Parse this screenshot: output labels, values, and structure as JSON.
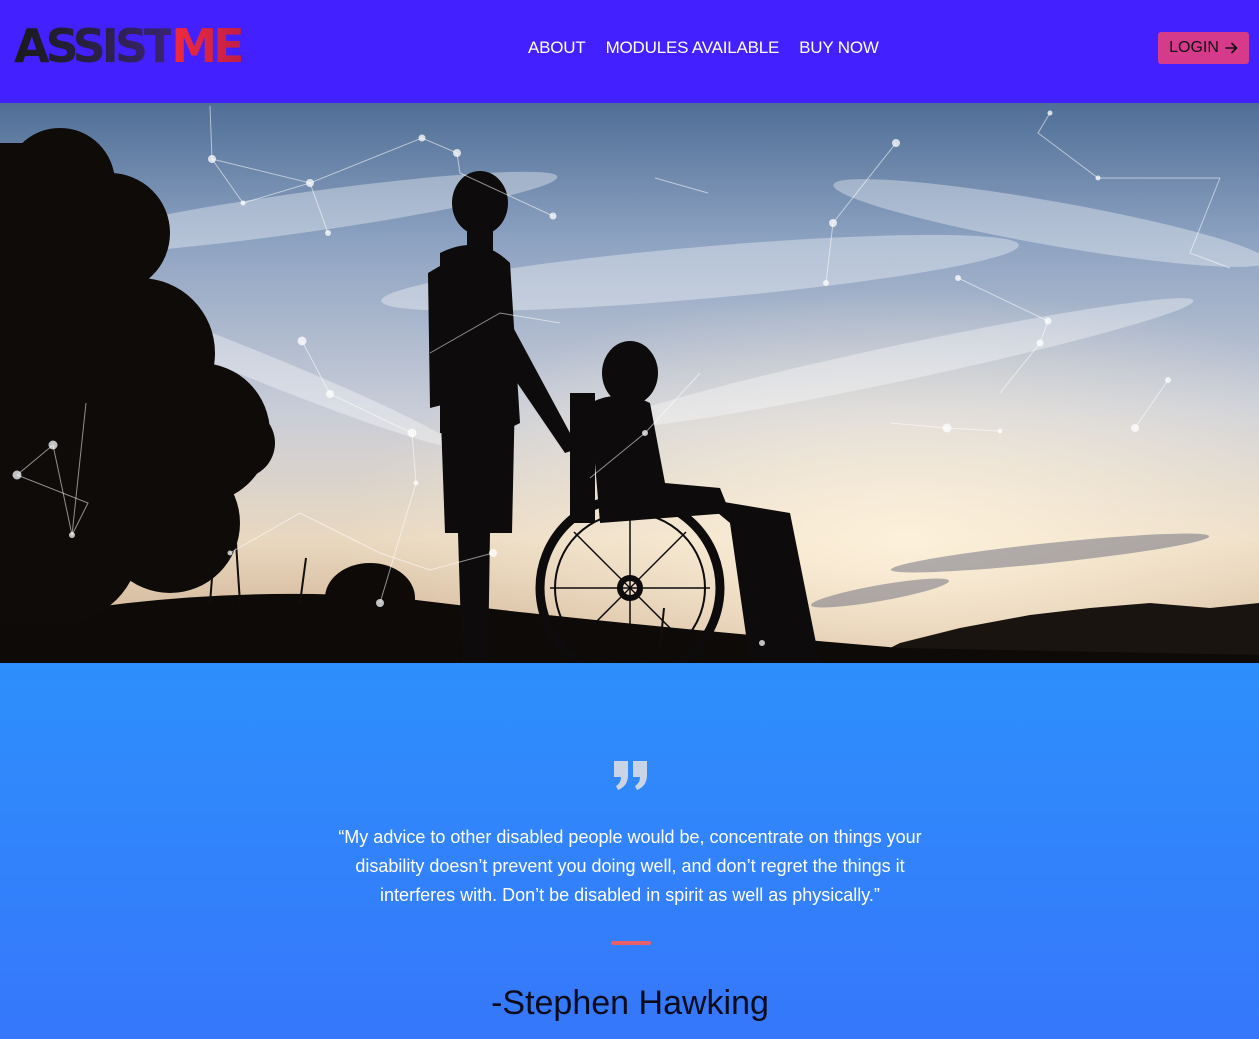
{
  "brand": {
    "logo_part1": "ASSIST",
    "logo_part2": "ME"
  },
  "nav": {
    "items": [
      {
        "label": "ABOUT"
      },
      {
        "label": "MODULES AVAILABLE"
      },
      {
        "label": "BUY NOW"
      }
    ],
    "login_label": "LOGIN",
    "login_icon": "arrow-right-icon"
  },
  "colors": {
    "header_bg": "#4220ff",
    "login_bg": "#d53a8b",
    "quote_bg_top": "#2d8ffb",
    "quote_bg_bottom": "#3677fb",
    "divider": "#e8606a"
  },
  "hero": {
    "image": "silhouette of a man pushing a person in a wheelchair at sunset with constellation network overlay"
  },
  "quote": {
    "icon": "quote-icon",
    "text": "“My advice to other disabled people would be, concentrate on things your disability doesn’t prevent you doing well, and don’t regret the things it interferes with. Don’t be disabled in spirit as well as physically.”",
    "author": "-Stephen Hawking"
  }
}
